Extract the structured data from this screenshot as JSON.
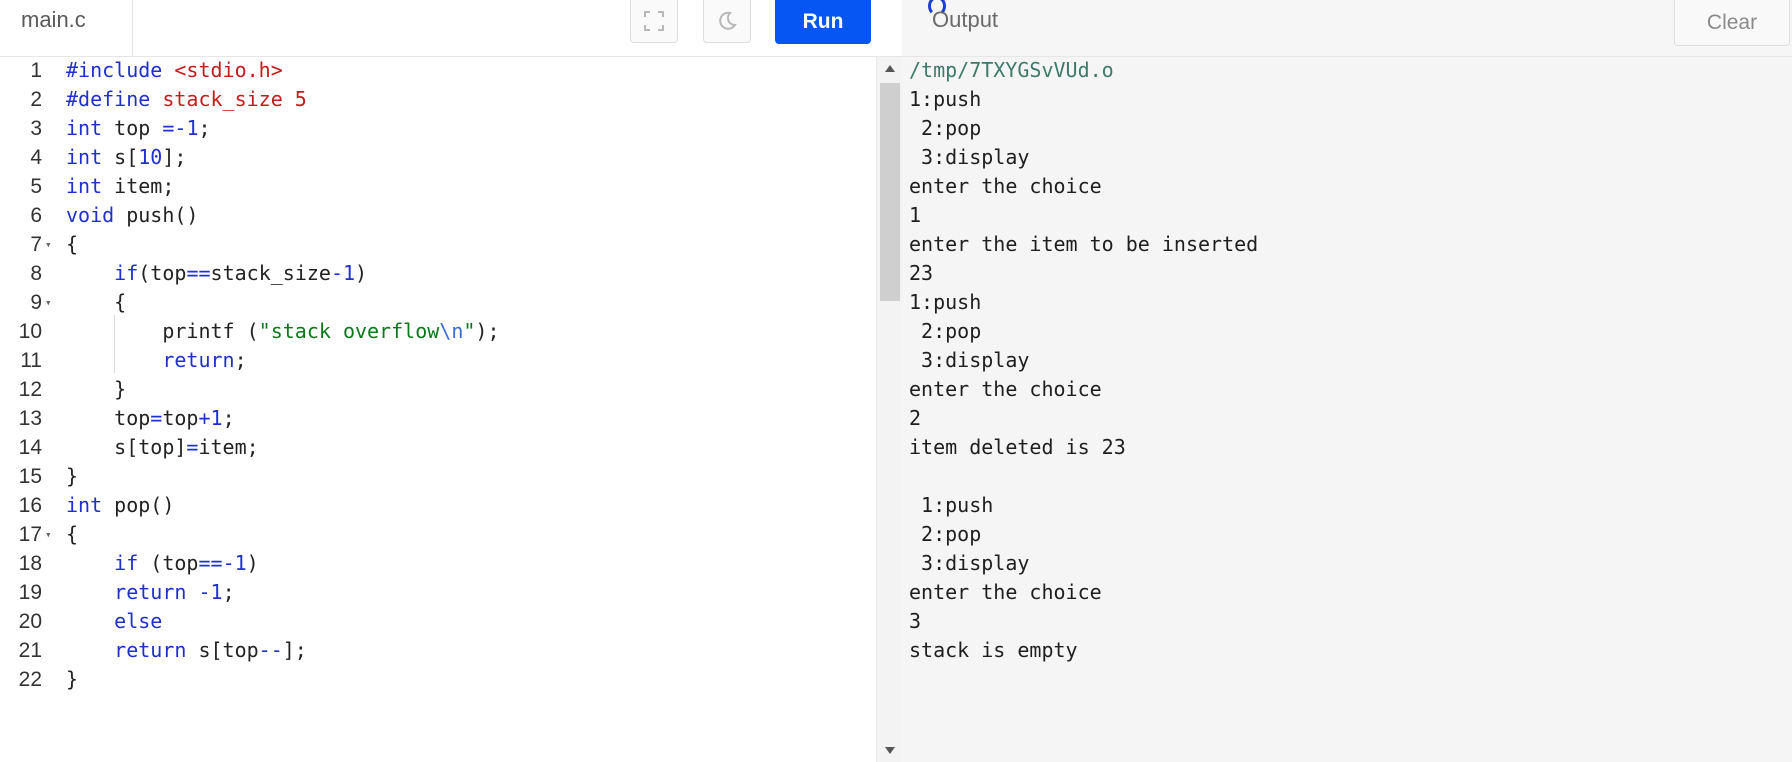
{
  "editor": {
    "file_tab": "main.c",
    "lines": [
      {
        "n": "1",
        "fold": false
      },
      {
        "n": "2",
        "fold": false
      },
      {
        "n": "3",
        "fold": false
      },
      {
        "n": "4",
        "fold": false
      },
      {
        "n": "5",
        "fold": false
      },
      {
        "n": "6",
        "fold": false
      },
      {
        "n": "7",
        "fold": true
      },
      {
        "n": "8",
        "fold": false
      },
      {
        "n": "9",
        "fold": true
      },
      {
        "n": "10",
        "fold": false
      },
      {
        "n": "11",
        "fold": false
      },
      {
        "n": "12",
        "fold": false
      },
      {
        "n": "13",
        "fold": false
      },
      {
        "n": "14",
        "fold": false
      },
      {
        "n": "15",
        "fold": false
      },
      {
        "n": "16",
        "fold": false
      },
      {
        "n": "17",
        "fold": true
      },
      {
        "n": "18",
        "fold": false
      },
      {
        "n": "19",
        "fold": false
      },
      {
        "n": "20",
        "fold": false
      },
      {
        "n": "21",
        "fold": false
      },
      {
        "n": "22",
        "fold": false
      }
    ],
    "code": [
      "#include <stdio.h>",
      "#define stack_size 5",
      "int top =-1;",
      "int s[10];",
      "int item;",
      "void push()",
      "{",
      "    if(top==stack_size-1)",
      "    {",
      "        printf (\"stack overflow\\n\");",
      "        return;",
      "    }",
      "    top=top+1;",
      "    s[top]=item;",
      "}",
      "int pop()",
      "{",
      "    if (top==-1)",
      "    return -1;",
      "    else",
      "    return s[top--];",
      "}"
    ]
  },
  "toolbar": {
    "fullscreen_icon": "fullscreen-icon",
    "theme_icon": "moon-icon",
    "run_label": "Run"
  },
  "output": {
    "title": "Output",
    "clear_label": "Clear",
    "lines": [
      "/tmp/7TXYGSvVUd.o",
      "1:push",
      " 2:pop",
      " 3:display",
      "enter the choice",
      "1",
      "enter the item to be inserted",
      "23",
      "1:push",
      " 2:pop",
      " 3:display",
      "enter the choice",
      "2",
      "item deleted is 23",
      "",
      " 1:push",
      " 2:pop",
      " 3:display",
      "enter the choice",
      "3",
      "stack is empty"
    ]
  },
  "colors": {
    "run_button": "#0556f3",
    "keyword": "#1f2fd0",
    "string": "#0a7a1a",
    "include_path": "#c21c1c",
    "output_path": "#3e7a6a"
  }
}
